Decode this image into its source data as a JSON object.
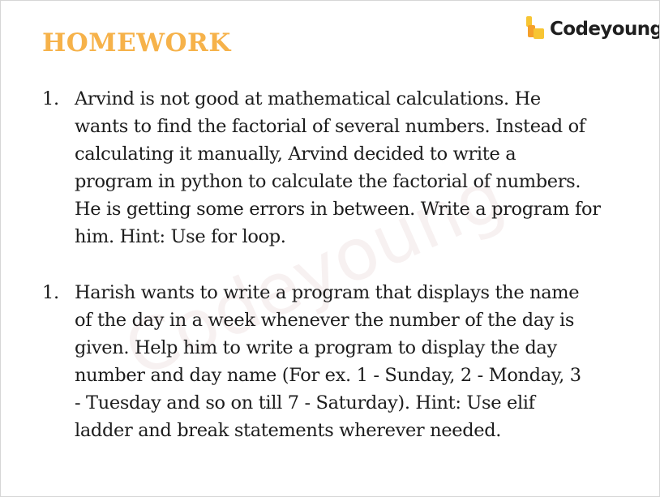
{
  "slide": {
    "title": "HOMEWORK",
    "brand": {
      "logo_text": "Codeyoung",
      "logo_icon": "codeyoung-logo-icon",
      "watermark_text": "Codeyoung"
    },
    "colors": {
      "title": "#f6b24a",
      "logo_yellow": "#f7c533",
      "logo_orange": "#f5a02b",
      "body_text": "#1c1c1c"
    },
    "questions": [
      {
        "number": "1.",
        "lines": [
          "Arvind is not good at mathematical calculations. He",
          "wants to find the factorial of several numbers. Instead of",
          "calculating it manually, Arvind decided to write a",
          "program in python to calculate the factorial of numbers.",
          "He is getting some errors in between. Write a program for",
          "him. Hint: Use for loop."
        ]
      },
      {
        "number": "1.",
        "lines": [
          "Harish wants to write a program that displays the name",
          "of the day in a week whenever the number of the day is",
          "given. Help him to write a program to display the day",
          "number and day name (For ex. 1 - Sunday, 2 - Monday, 3",
          "- Tuesday and so on till 7 - Saturday). Hint: Use elif",
          "ladder and break statements wherever needed."
        ]
      }
    ]
  }
}
